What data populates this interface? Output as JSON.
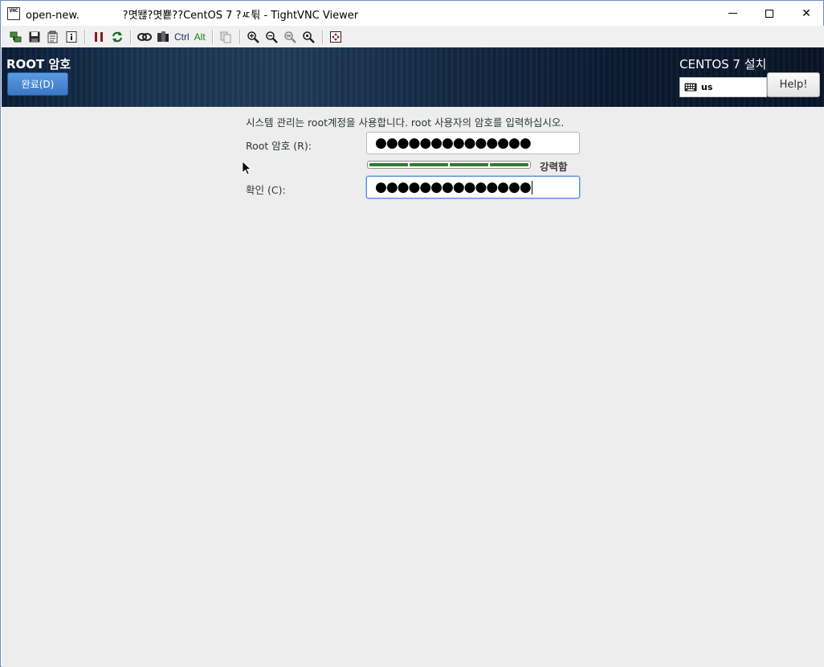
{
  "window": {
    "title": "open-new.             ?몃뙎?몃뿉??CentOS 7 ?ㅼ튂 - TightVNC Viewer",
    "icon_text": "VNC",
    "minimize_icon": "minimize-icon",
    "maximize_icon": "maximize-icon",
    "close_glyph": "✕"
  },
  "toolbar": {
    "items": [
      {
        "icon": "new-connection-icon"
      },
      {
        "icon": "save-icon"
      },
      {
        "icon": "options-icon"
      },
      {
        "icon": "info-icon"
      },
      {
        "icon": "pause-icon"
      },
      {
        "icon": "refresh-icon"
      },
      {
        "icon": "ctrl-alt-del-icon"
      },
      {
        "icon": "ctrl-esc-icon"
      },
      {
        "icon": "copy-icon"
      },
      {
        "icon": "zoom-in-icon"
      },
      {
        "icon": "zoom-out-icon"
      },
      {
        "icon": "zoom-100-icon"
      },
      {
        "icon": "zoom-auto-icon"
      },
      {
        "icon": "fullscreen-icon"
      }
    ],
    "ctrl_label": "Ctrl",
    "alt_label": "Alt"
  },
  "header": {
    "page_title": "ROOT 암호",
    "done_button": "완료(D)",
    "product_title": "CENTOS 7 설치",
    "keyboard_layout": "us",
    "help_button": "Help!"
  },
  "form": {
    "description": "시스템 관리는 root계정을 사용합니다. root 사용자의 암호를 입력하십시오.",
    "root_label": "Root 암호 (R):",
    "root_value": "●●●●●●●●●●●●●●",
    "strength_label": "강력함",
    "strength_level": 1.0,
    "strength_color": "#2e7d32",
    "confirm_label": "확인 (C):",
    "confirm_value": "●●●●●●●●●●●●●●"
  }
}
